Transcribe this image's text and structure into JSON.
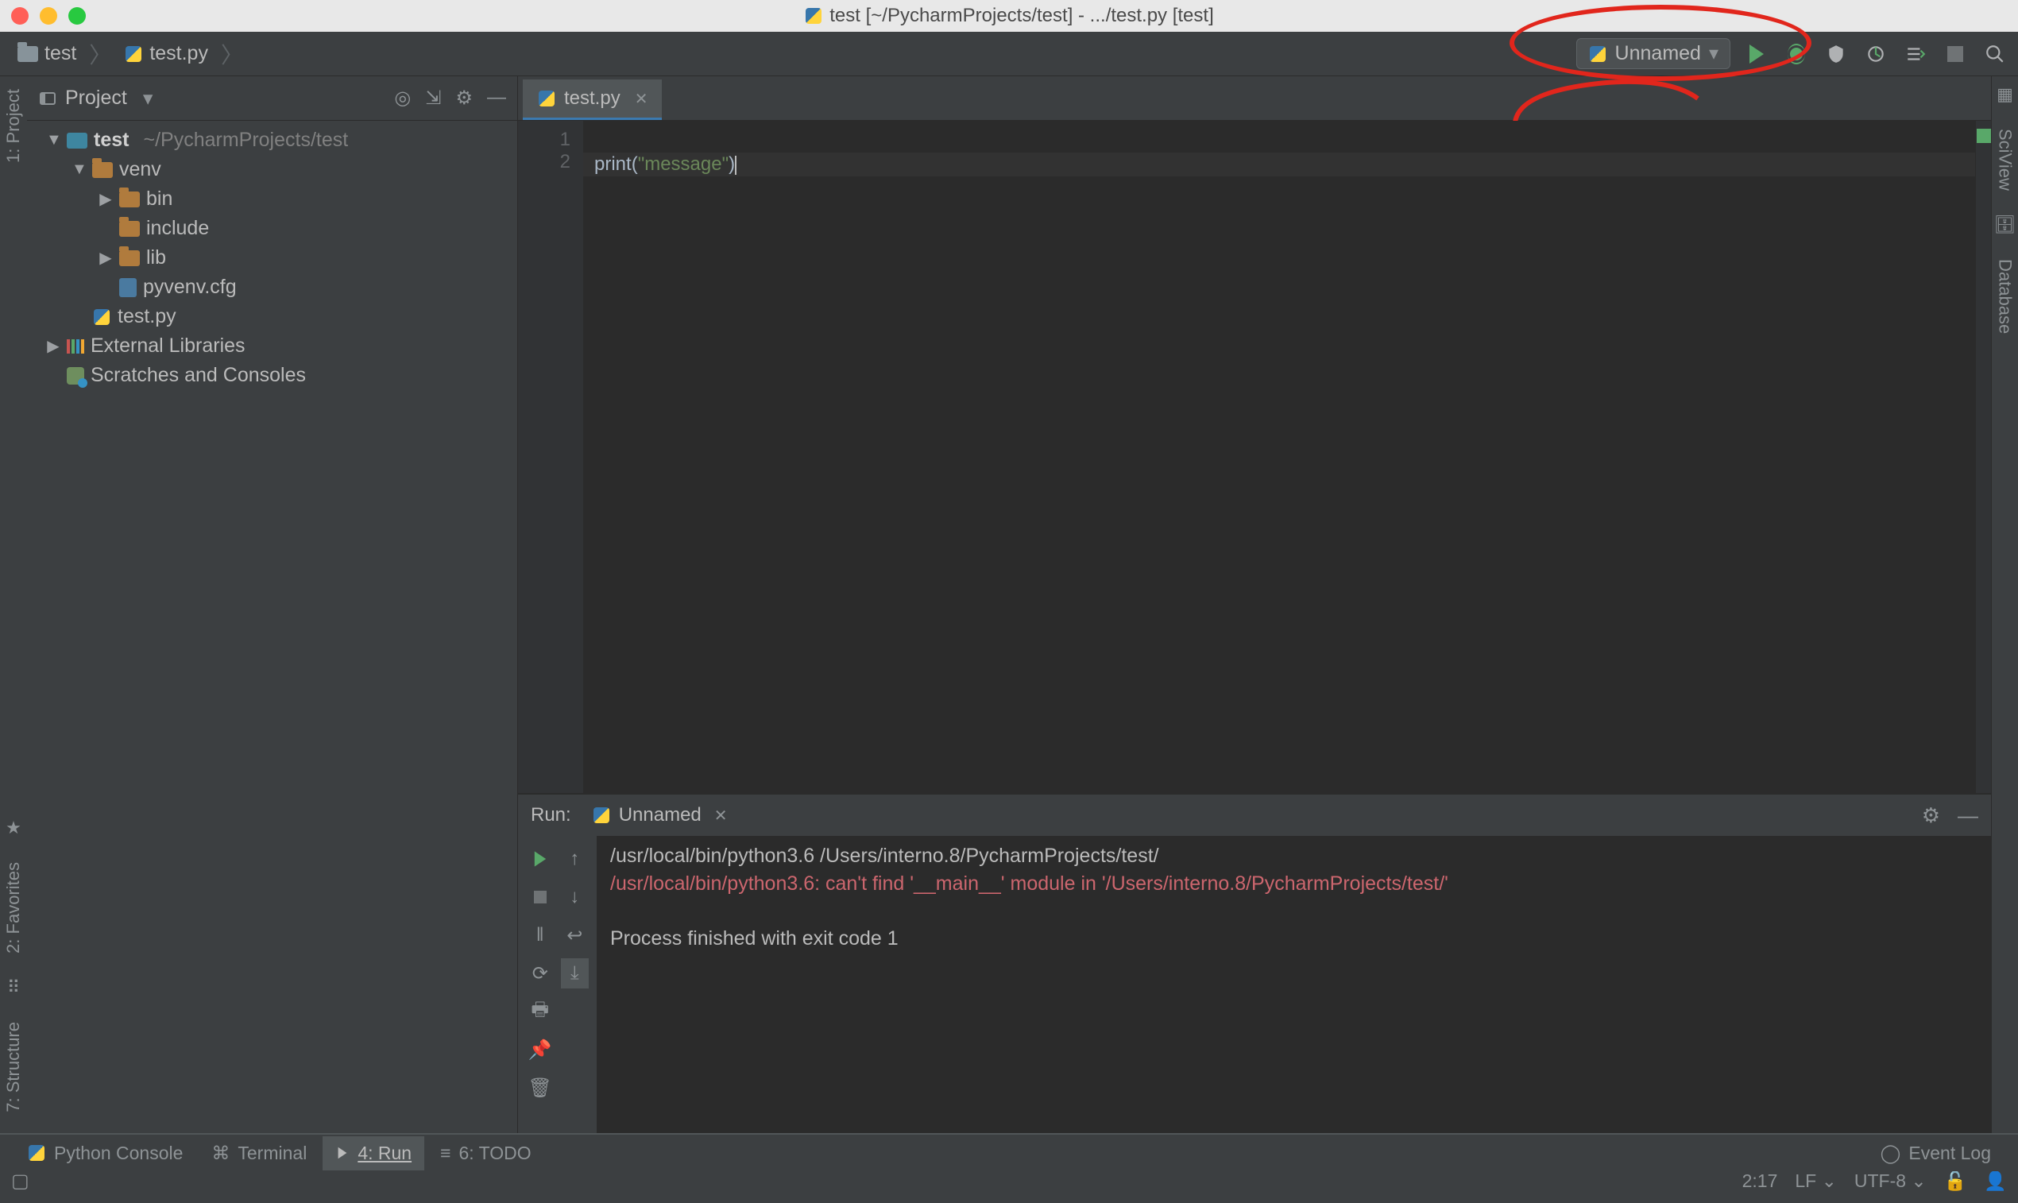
{
  "window": {
    "title": "test [~/PycharmProjects/test] - .../test.py [test]"
  },
  "breadcrumb": {
    "project": "test",
    "file": "test.py"
  },
  "toolbar": {
    "run_config_label": "Unnamed"
  },
  "project_panel": {
    "header": "Project",
    "root_name": "test",
    "root_path": "~/PycharmProjects/test",
    "venv": "venv",
    "bin": "bin",
    "include": "include",
    "lib": "lib",
    "pyvenv": "pyvenv.cfg",
    "testpy": "test.py",
    "ext_lib": "External Libraries",
    "scratch": "Scratches and Consoles"
  },
  "left_strip": {
    "project": "1: Project"
  },
  "left_strip2": {
    "favorites": "2: Favorites",
    "structure": "7: Structure"
  },
  "right_strip": {
    "sciview": "SciView",
    "database": "Database"
  },
  "editor": {
    "tab": "test.py",
    "gutter": [
      "1",
      "2"
    ],
    "code": {
      "func": "print",
      "open": "(",
      "string": "\"message\"",
      "close": ")"
    }
  },
  "run": {
    "title": "Run:",
    "tab": "Unnamed",
    "lines": {
      "l1": "/usr/local/bin/python3.6 /Users/interno.8/PycharmProjects/test/",
      "l2": "/usr/local/bin/python3.6: can't find '__main__' module in '/Users/interno.8/PycharmProjects/test/'",
      "l3": "",
      "l4": "Process finished with exit code 1"
    }
  },
  "bottom_tabs": {
    "python_console": "Python Console",
    "terminal": "Terminal",
    "run": "4: Run",
    "todo": "6: TODO",
    "event_log": "Event Log"
  },
  "status": {
    "cursor": "2:17",
    "line_sep": "LF",
    "encoding": "UTF-8"
  }
}
